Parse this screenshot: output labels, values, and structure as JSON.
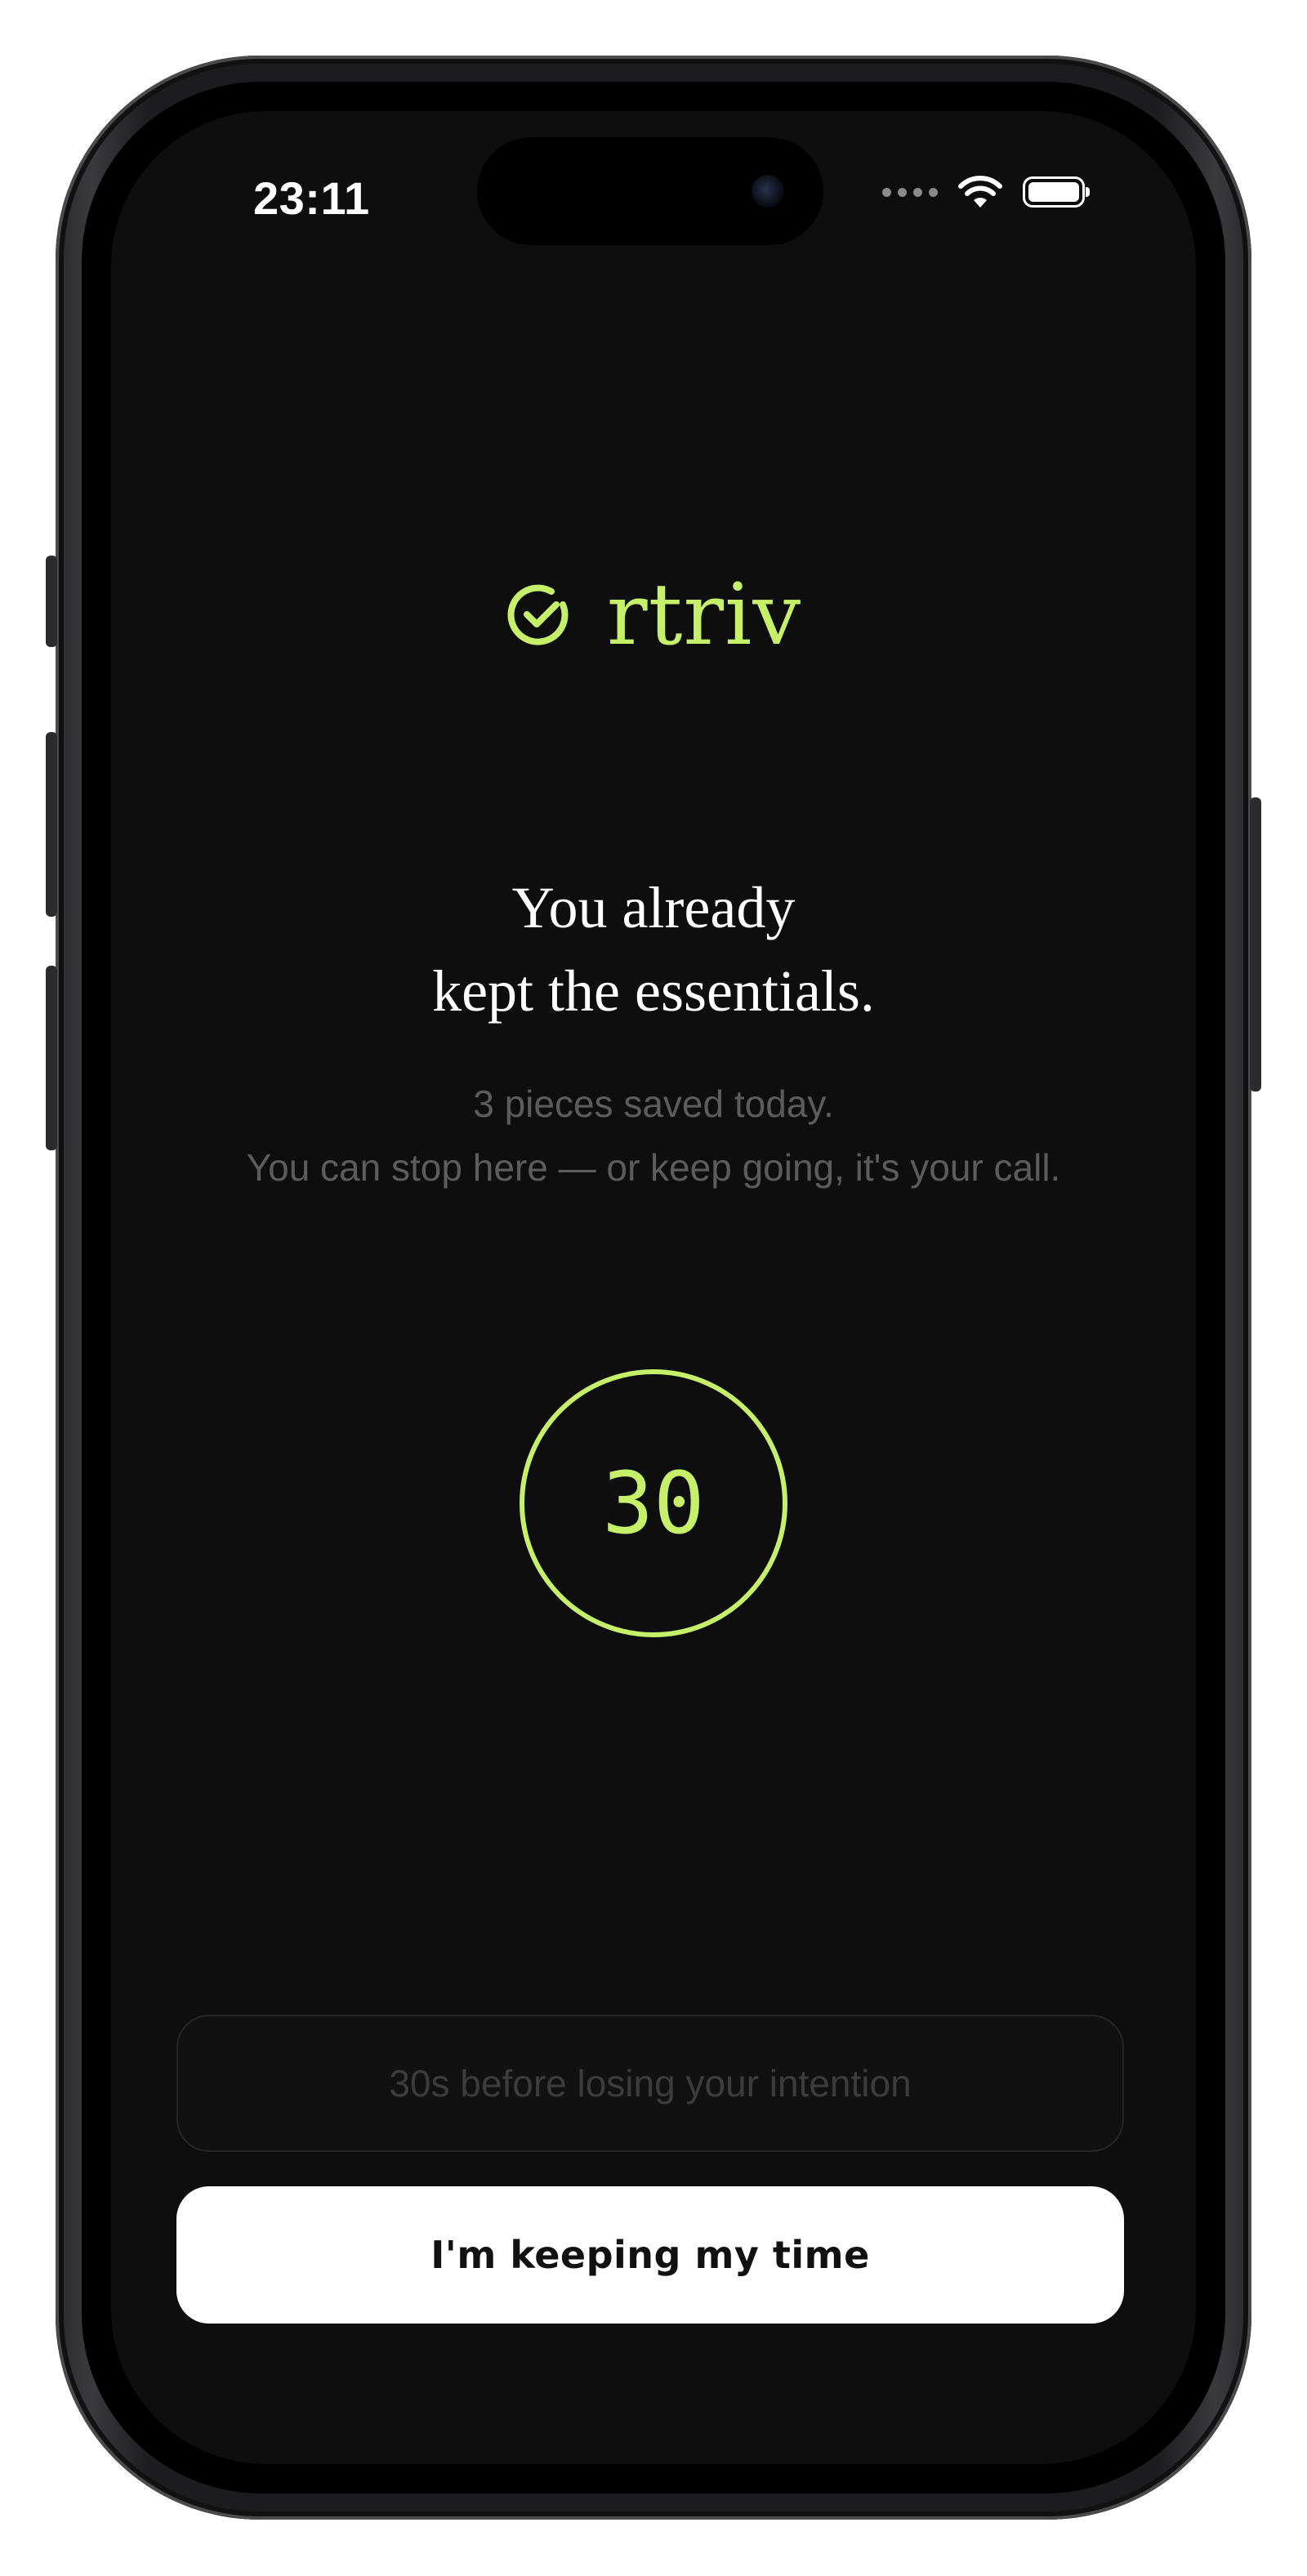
{
  "status_bar": {
    "time": "23:11"
  },
  "brand": {
    "name": "rtriv",
    "icon": "check-circle-icon",
    "color": "#c6ef6a"
  },
  "message": {
    "headline_line1": "You already",
    "headline_line2": "kept the essentials.",
    "subtext_line1": "3 pieces saved today.",
    "subtext_line2": "You can stop here — or keep going, it's your call."
  },
  "timer": {
    "value": "30"
  },
  "actions": {
    "countdown_label": "30s before losing your intention",
    "keep_label": "I'm keeping my time"
  }
}
